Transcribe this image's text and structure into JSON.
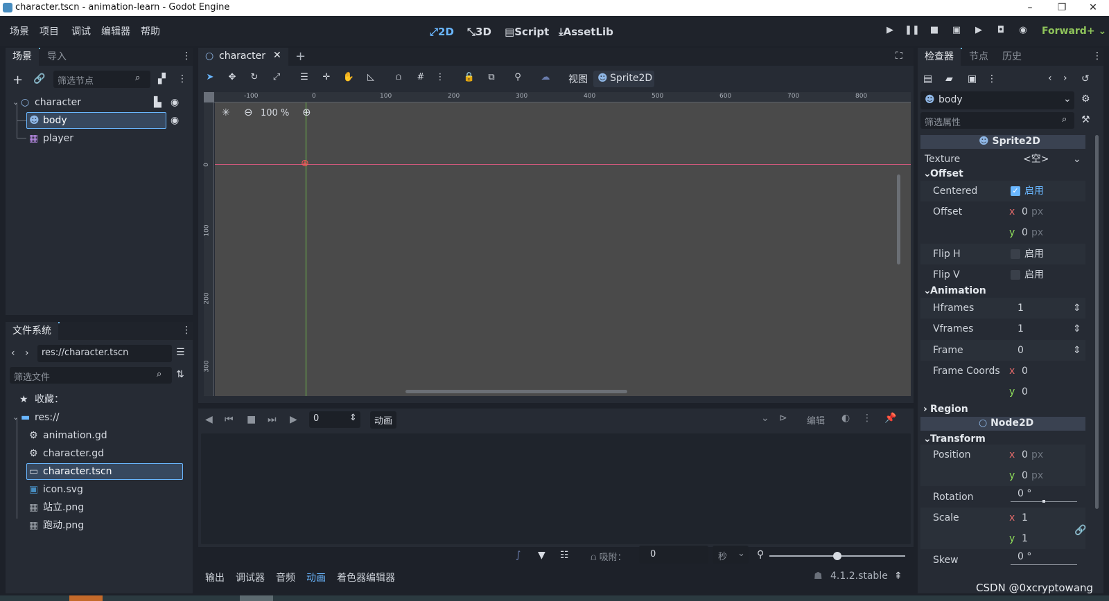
{
  "window": {
    "title": "character.tscn - animation-learn - Godot Engine",
    "min": "–",
    "max": "❐",
    "close": "✕"
  },
  "menu": [
    "场景",
    "项目",
    "调试",
    "编辑器",
    "帮助"
  ],
  "workspaces": {
    "d2": "2D",
    "d3": "3D",
    "script": "Script",
    "assetlib": "AssetLib"
  },
  "renderer": "Forward+",
  "scene_dock": {
    "tabs": [
      "场景",
      "导入"
    ],
    "filter_placeholder": "筛选节点",
    "nodes": [
      {
        "name": "character",
        "icon": "node2d-icon",
        "depth": 0
      },
      {
        "name": "body",
        "icon": "sprite2d-icon",
        "depth": 1,
        "selected": true
      },
      {
        "name": "player",
        "icon": "animatedsprite-icon",
        "depth": 1
      }
    ]
  },
  "filesystem": {
    "tab": "文件系统",
    "path": "res://character.tscn",
    "filter_placeholder": "筛选文件",
    "favorites": "收藏：",
    "root": "res://",
    "files": [
      {
        "name": "animation.gd",
        "icon": "gear-icon"
      },
      {
        "name": "character.gd",
        "icon": "gear-icon"
      },
      {
        "name": "character.tscn",
        "icon": "scene-icon",
        "selected": true
      },
      {
        "name": "icon.svg",
        "icon": "image-icon"
      },
      {
        "name": "站立.png",
        "icon": "image-icon"
      },
      {
        "name": "跑动.png",
        "icon": "image-icon"
      }
    ]
  },
  "editor": {
    "tab": "character",
    "view_menu": "视图",
    "sprite_menu": "Sprite2D",
    "zoom": "100 %",
    "ruler_top": [
      "-100",
      "0",
      "100",
      "200",
      "300",
      "400",
      "500",
      "600",
      "700",
      "800"
    ],
    "ruler_left": [
      "0",
      "100",
      "200",
      "300"
    ]
  },
  "animation": {
    "frame": "0",
    "label": "动画",
    "edit": "编辑",
    "snap_label": "吸附：",
    "snap_value": "0",
    "unit": "秒"
  },
  "bottom_tabs": [
    "输出",
    "调试器",
    "音频",
    "动画",
    "着色器编辑器"
  ],
  "bottom_tabs_active": "动画",
  "version": "4.1.2.stable",
  "inspector": {
    "tabs": [
      "检查器",
      "节点",
      "历史"
    ],
    "object": "body",
    "filter_placeholder": "筛选属性",
    "class_header": "Sprite2D",
    "texture_label": "Texture",
    "texture_value": "<空>",
    "offset_section": "Offset",
    "centered_label": "Centered",
    "enable": "启用",
    "offset_label": "Offset",
    "offset_x": "0",
    "offset_y": "0",
    "px": "px",
    "fliph": "Flip H",
    "flipv": "Flip V",
    "anim_section": "Animation",
    "hframes": "Hframes",
    "hframes_v": "1",
    "vframes": "Vframes",
    "vframes_v": "1",
    "frame": "Frame",
    "frame_v": "0",
    "frame_coords": "Frame Coords",
    "fc_x": "0",
    "fc_y": "0",
    "region": "Region",
    "node2d_header": "Node2D",
    "transform": "Transform",
    "position": "Position",
    "pos_x": "0",
    "pos_y": "0",
    "rotation": "Rotation",
    "rotation_v": "0 °",
    "scale": "Scale",
    "scale_x": "1",
    "scale_y": "1",
    "skew": "Skew",
    "skew_v": "0 °",
    "x": "x",
    "y": "y"
  },
  "watermark": "CSDN @0xcryptowang",
  "colors": {
    "accent": "#6ab7ff",
    "panel": "#262b34",
    "base": "#1d2129",
    "viewport": "#4a4a4a"
  }
}
